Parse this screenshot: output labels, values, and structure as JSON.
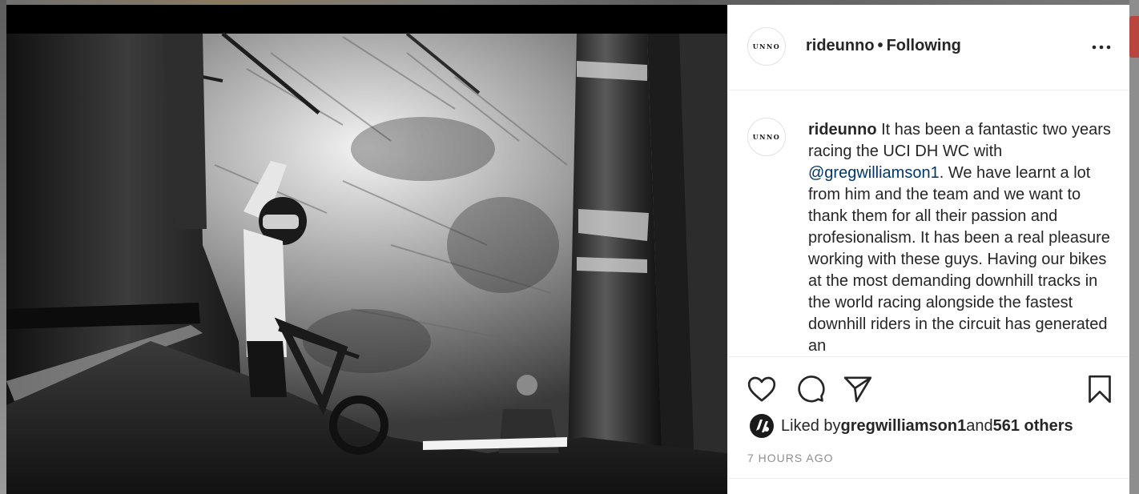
{
  "post": {
    "author": "rideunno",
    "separator": "•",
    "follow_status": "Following",
    "avatar_logo_text": "UNNO",
    "caption_user": "rideunno",
    "caption_part1": " It has been a fantastic two years racing the UCI DH WC with ",
    "caption_mention": "@gregwilliamson1",
    "caption_part2": ". We have learnt a lot from him and the team and we want to thank them for all their passion and profesionalism. It has been a real pleasure working with these guys. Having our bikes at the most demanding downhill tracks in the world racing alongside the fastest downhill riders in the circuit has generated an",
    "likes_prefix": "Liked by ",
    "liked_by_user": "gregwilliamson1",
    "likes_and": " and ",
    "likes_count": "561 others",
    "timestamp": "7 HOURS AGO"
  },
  "icons": {
    "more": "more-options-icon",
    "like": "heart-icon",
    "comment": "comment-bubble-icon",
    "share": "paper-plane-icon",
    "save": "bookmark-icon"
  },
  "colors": {
    "text": "#262626",
    "mention": "#00376b",
    "muted": "#8e8e8e",
    "divider": "#efefef"
  }
}
